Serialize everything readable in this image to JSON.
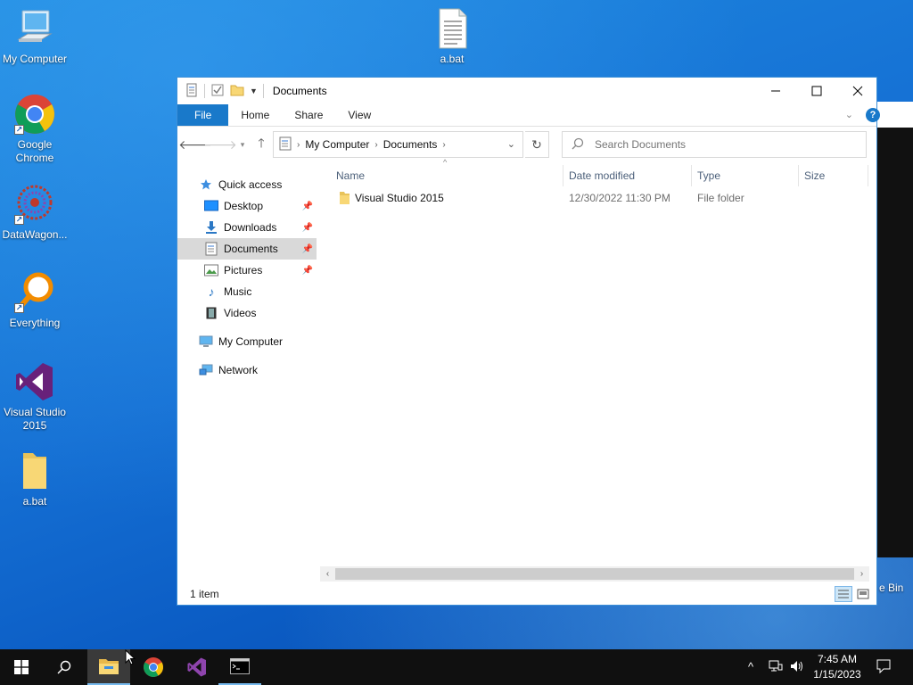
{
  "desktop": {
    "icons": [
      {
        "label": "My Computer"
      },
      {
        "label": "Google Chrome"
      },
      {
        "label": "DataWagon..."
      },
      {
        "label": "Everything"
      },
      {
        "label": "Visual Studio 2015"
      },
      {
        "label": "a.bat"
      },
      {
        "label": "a.bat"
      }
    ],
    "recycle_bin_label": "e Bin"
  },
  "window": {
    "title": "Documents",
    "ribbon_tabs": [
      "File",
      "Home",
      "Share",
      "View"
    ],
    "help_glyph": "?",
    "address": {
      "segments": [
        "My Computer",
        "Documents"
      ]
    },
    "search": {
      "placeholder": "Search Documents"
    },
    "nav_pane": {
      "quick_access": "Quick access",
      "items": [
        {
          "label": "Desktop",
          "icon": "desktop-icon",
          "pinned": true
        },
        {
          "label": "Downloads",
          "icon": "downloads-icon",
          "pinned": true
        },
        {
          "label": "Documents",
          "icon": "documents-icon",
          "pinned": true,
          "selected": true
        },
        {
          "label": "Pictures",
          "icon": "pictures-icon",
          "pinned": true
        },
        {
          "label": "Music",
          "icon": "music-icon",
          "pinned": false
        },
        {
          "label": "Videos",
          "icon": "videos-icon",
          "pinned": false
        }
      ],
      "my_computer": "My Computer",
      "network": "Network"
    },
    "columns": {
      "name": "Name",
      "date_modified": "Date modified",
      "type": "Type",
      "size": "Size"
    },
    "files": [
      {
        "name": "Visual Studio 2015",
        "date_modified": "12/30/2022 11:30 PM",
        "type": "File folder",
        "size": ""
      }
    ],
    "status": {
      "item_count": "1 item"
    }
  },
  "taskbar": {
    "clock_time": "7:45 AM",
    "clock_date": "1/15/2023"
  },
  "colors": {
    "accent": "#1979ca",
    "taskbar": "#101010"
  }
}
